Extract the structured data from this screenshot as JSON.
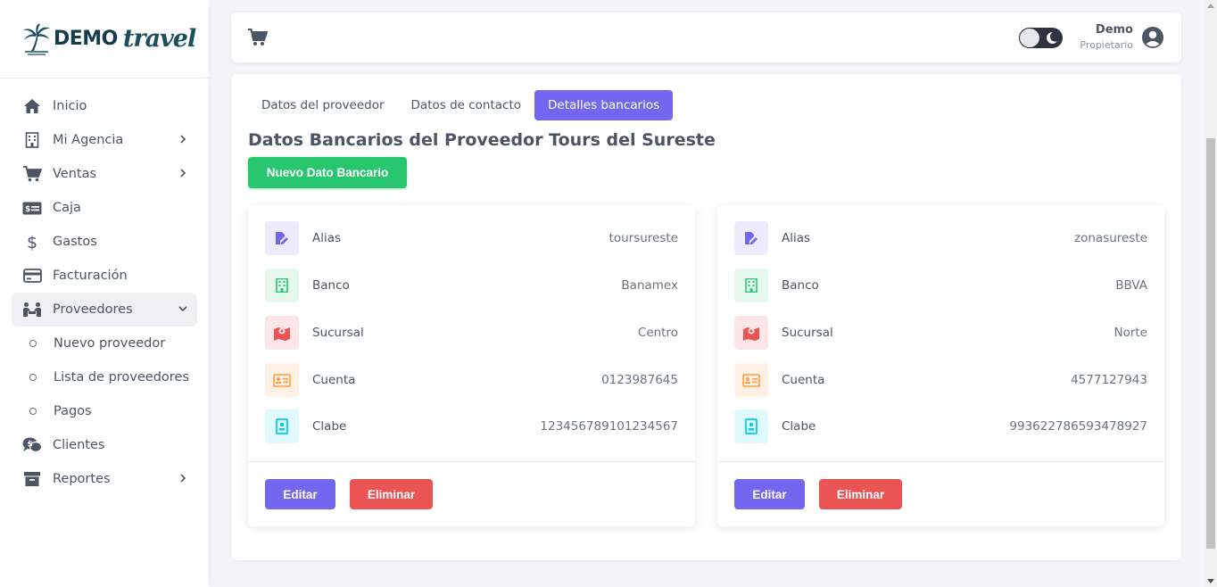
{
  "brand": {
    "name": "DEMO",
    "script": "travel"
  },
  "sidebar": {
    "items": [
      {
        "label": "Inicio",
        "icon": "home-icon"
      },
      {
        "label": "Mi Agencia",
        "icon": "building-icon"
      },
      {
        "label": "Ventas",
        "icon": "cart-icon"
      },
      {
        "label": "Caja",
        "icon": "cash-icon"
      },
      {
        "label": "Gastos",
        "icon": "dollar-icon"
      },
      {
        "label": "Facturación",
        "icon": "credit-card-icon"
      },
      {
        "label": "Proveedores",
        "icon": "people-icon"
      },
      {
        "label": "Clientes",
        "icon": "chat-money-icon"
      },
      {
        "label": "Reportes",
        "icon": "archive-icon"
      }
    ],
    "submenu": [
      {
        "label": "Nuevo proveedor"
      },
      {
        "label": "Lista de proveedores"
      },
      {
        "label": "Pagos"
      }
    ]
  },
  "navbar": {
    "user_name": "Demo",
    "user_role": "Propietario"
  },
  "tabs": [
    {
      "label": "Datos del proveedor"
    },
    {
      "label": "Datos de contacto"
    },
    {
      "label": "Detalles bancarios"
    }
  ],
  "section_title": "Datos Bancarios del Proveedor Tours del Sureste",
  "new_button": "Nuevo Dato Bancario",
  "cards": [
    {
      "rows": [
        {
          "label": "Alias",
          "value": "toursureste",
          "color": "#7367f0"
        },
        {
          "label": "Banco",
          "value": "Banamex",
          "color": "#28c76f"
        },
        {
          "label": "Sucursal",
          "value": "Centro",
          "color": "#ea5455"
        },
        {
          "label": "Cuenta",
          "value": "0123987645",
          "color": "#ff9f43"
        },
        {
          "label": "Clabe",
          "value": "123456789101234567",
          "color": "#00cfe8"
        }
      ],
      "edit": "Editar",
      "delete": "Eliminar"
    },
    {
      "rows": [
        {
          "label": "Alias",
          "value": "zonasureste",
          "color": "#7367f0"
        },
        {
          "label": "Banco",
          "value": "BBVA",
          "color": "#28c76f"
        },
        {
          "label": "Sucursal",
          "value": "Norte",
          "color": "#ea5455"
        },
        {
          "label": "Cuenta",
          "value": "4577127943",
          "color": "#ff9f43"
        },
        {
          "label": "Clabe",
          "value": "993622786593478927",
          "color": "#00cfe8"
        }
      ],
      "edit": "Editar",
      "delete": "Eliminar"
    }
  ]
}
